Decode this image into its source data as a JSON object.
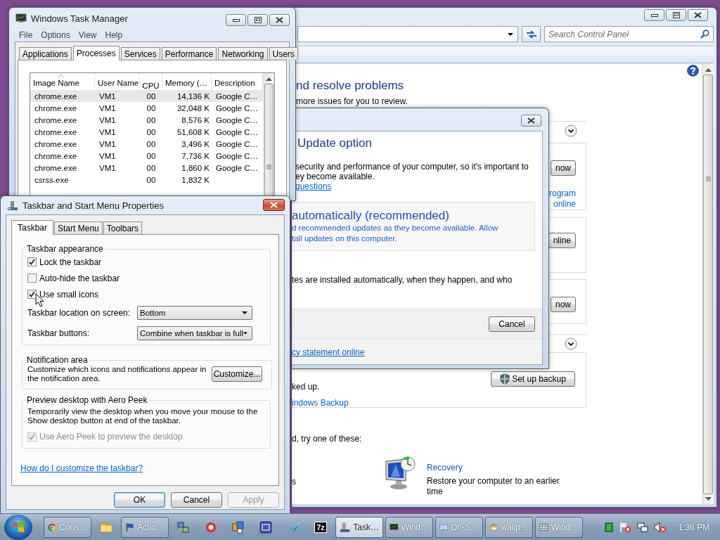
{
  "control_panel": {
    "search": {
      "placeholder": "Search Control Panel"
    },
    "heading": "nd resolve problems",
    "intro": "more issues for you to review.",
    "boxes": [
      {
        "button": "now",
        "links": [
          "rogram",
          "online"
        ]
      },
      {
        "button": "nline"
      },
      {
        "button": "now"
      }
    ],
    "backup": {
      "button": "Set up backup",
      "text": "ked up.",
      "link": "indows Backup"
    },
    "prompt": "d, try one of these:",
    "option_fragment": "s",
    "recovery": {
      "title": "Recovery",
      "text": "Restore your computer to an earlier time"
    }
  },
  "update_dialog": {
    "heading": "Update option",
    "text": "security and performance of your computer, so it's important to",
    "text_2": "ey become available.",
    "link": "questions",
    "option": {
      "title": "automatically (recommended)",
      "text": "d recommended updates as they become available. Allow",
      "text_2": "tall updates on this computer."
    },
    "note": "tes are installed automatically, when they happen, and who",
    "button": "Cancel",
    "footer_link": "cy statement online"
  },
  "task_manager": {
    "title": "Windows Task Manager",
    "menu": [
      "File",
      "Options",
      "View",
      "Help"
    ],
    "tabs": [
      {
        "label": "Applications",
        "selected": false
      },
      {
        "label": "Processes",
        "selected": true
      },
      {
        "label": "Services",
        "selected": false
      },
      {
        "label": "Performance",
        "selected": false
      },
      {
        "label": "Networking",
        "selected": false
      },
      {
        "label": "Users",
        "selected": false
      }
    ],
    "columns": [
      "Image Name",
      "User Name",
      "CPU",
      "Memory (…",
      "Description"
    ],
    "rows": [
      {
        "image": "chrome.exe",
        "user": "VM1",
        "cpu": "00",
        "memory": "14,136 K",
        "description": "Google C…",
        "selected": true
      },
      {
        "image": "chrome.exe",
        "user": "VM1",
        "cpu": "00",
        "memory": "32,048 K",
        "description": "Google C…",
        "selected": false
      },
      {
        "image": "chrome.exe",
        "user": "VM1",
        "cpu": "00",
        "memory": "8,576 K",
        "description": "Google C…",
        "selected": false
      },
      {
        "image": "chrome.exe",
        "user": "VM1",
        "cpu": "00",
        "memory": "51,608 K",
        "description": "Google C…",
        "selected": false
      },
      {
        "image": "chrome.exe",
        "user": "VM1",
        "cpu": "00",
        "memory": "3,496 K",
        "description": "Google C…",
        "selected": false
      },
      {
        "image": "chrome.exe",
        "user": "VM1",
        "cpu": "00",
        "memory": "7,736 K",
        "description": "Google C…",
        "selected": false
      },
      {
        "image": "chrome.exe",
        "user": "VM1",
        "cpu": "00",
        "memory": "1,860 K",
        "description": "Google C…",
        "selected": false
      },
      {
        "image": "csrss.exe",
        "cpu": "00",
        "memory": "1,832 K",
        "selected": false
      }
    ]
  },
  "taskbar_props": {
    "title": "Taskbar and Start Menu Properties",
    "tabs": [
      {
        "label": "Taskbar",
        "selected": true
      },
      {
        "label": "Start Menu",
        "selected": false
      },
      {
        "label": "Toolbars",
        "selected": false
      }
    ],
    "appearance": {
      "legend": "Taskbar appearance",
      "options": [
        {
          "label": "Lock the taskbar",
          "checked": true
        },
        {
          "label": "Auto-hide the taskbar",
          "checked": false
        },
        {
          "label": "Use small icons",
          "checked": true
        }
      ],
      "dropdowns": [
        {
          "label": "Taskbar location on screen:",
          "value": "Bottom"
        },
        {
          "label": "Taskbar buttons:",
          "value": "Combine when taskbar is full"
        }
      ]
    },
    "notification": {
      "legend": "Notification area",
      "text": "Customize which icons and notifications appear in the notification area.",
      "button": "Customize..."
    },
    "aero_peek": {
      "legend": "Preview desktop with Aero Peek",
      "text": "Temporarily view the desktop when you move your mouse to the Show desktop button at end of the taskbar.",
      "option": {
        "label": "Use Aero Peek to preview the desktop",
        "checked": true,
        "disabled": true
      }
    },
    "help_link": "How do I customize the taskbar?",
    "buttons": [
      {
        "label": "OK",
        "default": true,
        "disabled": false
      },
      {
        "label": "Cancel",
        "default": false,
        "disabled": false
      },
      {
        "label": "Apply",
        "default": false,
        "disabled": true
      }
    ]
  },
  "taskbar": {
    "items": [
      {
        "kind": "button",
        "label": "Cons…",
        "selected": false
      },
      {
        "kind": "icon",
        "selected": false
      },
      {
        "kind": "button",
        "label": "Actio…",
        "selected": false
      },
      {
        "kind": "icon",
        "selected": false
      },
      {
        "kind": "icon",
        "selected": false
      },
      {
        "kind": "icon",
        "selected": false
      },
      {
        "kind": "icon",
        "selected": false
      },
      {
        "kind": "icon",
        "selected": false
      },
      {
        "kind": "logo",
        "label": "7z",
        "selected": false
      },
      {
        "kind": "button",
        "label": "Task…",
        "selected": true
      },
      {
        "kind": "button",
        "label": "Wind…",
        "selected": false
      },
      {
        "kind": "button",
        "label": "On-S…",
        "selected": false
      },
      {
        "kind": "button",
        "label": "wallp…",
        "selected": false
      },
      {
        "kind": "button",
        "label": "Wind…",
        "selected": false
      }
    ],
    "clock": "1:36 PM"
  }
}
